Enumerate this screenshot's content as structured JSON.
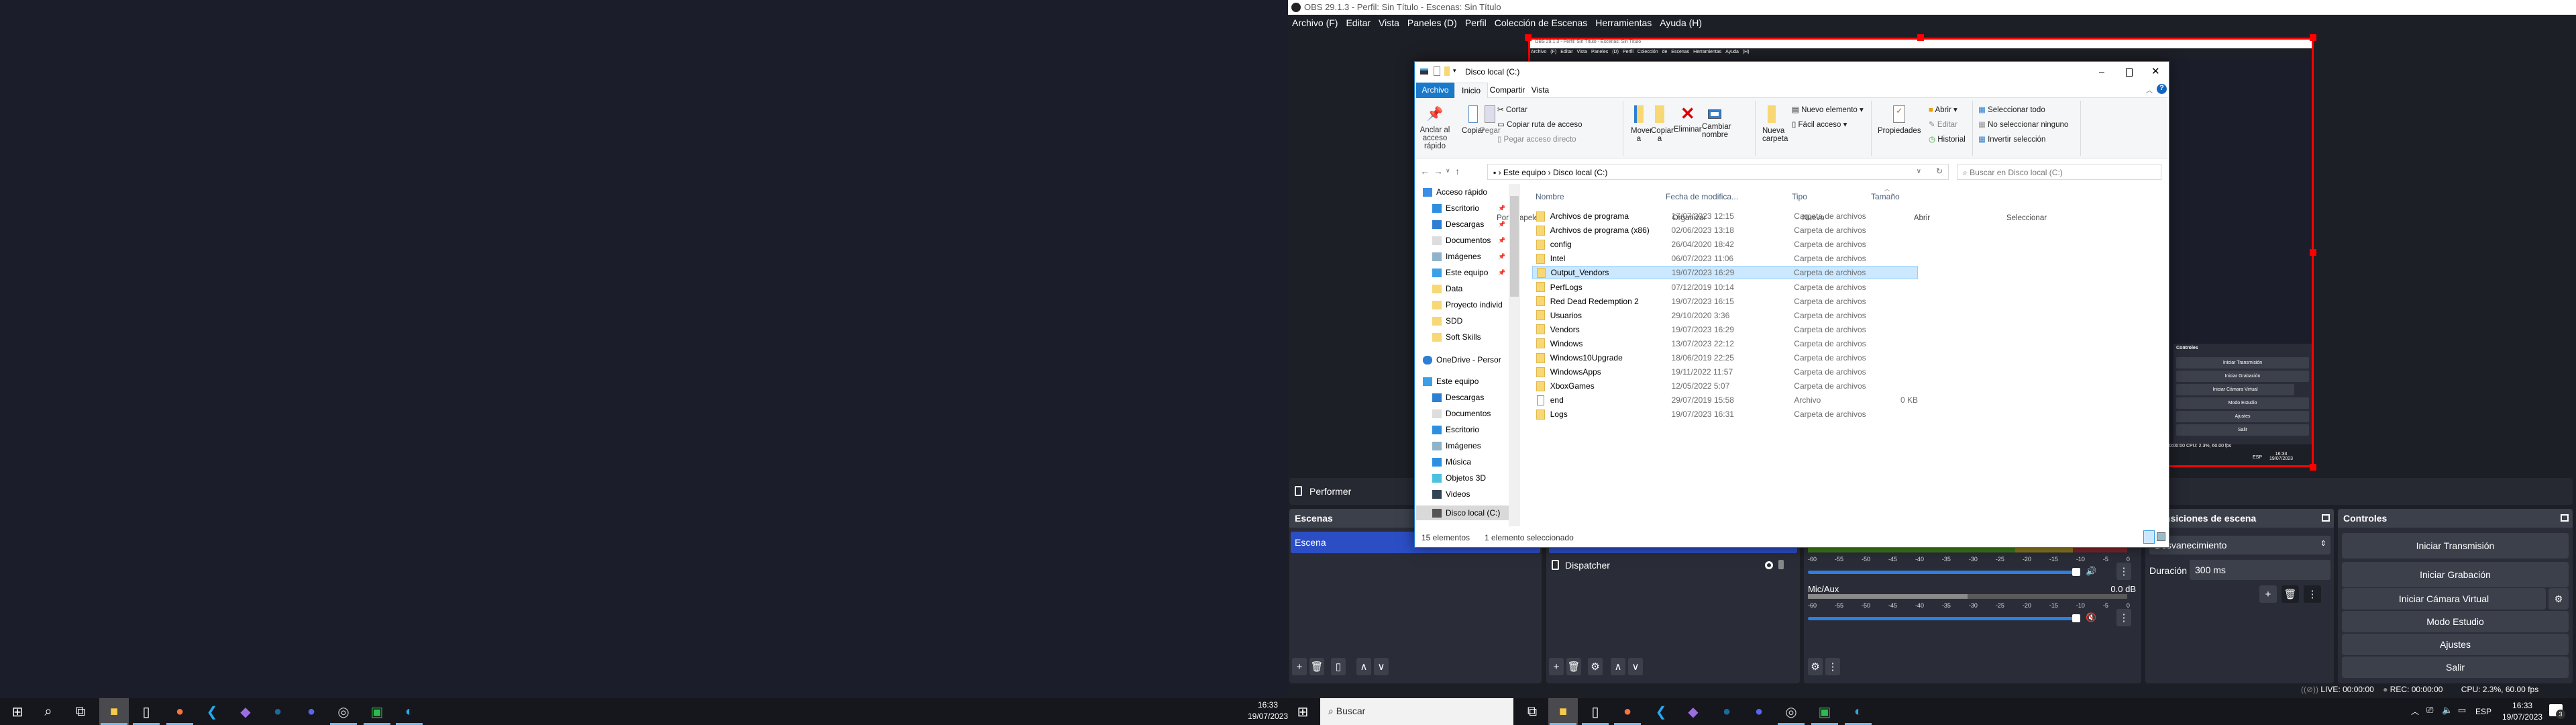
{
  "left_taskbar": {
    "apps": [
      "windows-start",
      "search",
      "task-view",
      "file-explorer",
      "notepad",
      "firefox",
      "vscode",
      "visual-studio",
      "steam",
      "discord",
      "obs",
      "green-app",
      "edge"
    ],
    "time": "16:33",
    "date": "19/07/2023"
  },
  "obs": {
    "title": "OBS 29.1.3 - Perfil: Sin Título - Escenas: Sin Título",
    "menu": [
      "Archivo (F)",
      "Editar",
      "Vista",
      "Paneles (D)",
      "Perfil",
      "Colección de Escenas",
      "Herramientas",
      "Ayuda (H)"
    ],
    "preview_source": "Performer",
    "scenes": {
      "title": "Escenas",
      "items": [
        "Escena"
      ]
    },
    "sources": {
      "items": [
        "Dispatcher"
      ]
    },
    "mixer": {
      "ticks": [
        "-60",
        "-55",
        "-50",
        "-45",
        "-40",
        "-35",
        "-30",
        "-25",
        "-20",
        "-15",
        "-10",
        "-5",
        "0"
      ],
      "channels": [
        {
          "name": "",
          "db": "",
          "volume": 1.0,
          "muted": false
        },
        {
          "name": "Mic/Aux",
          "db": "0.0 dB",
          "volume": 1.0,
          "muted": true
        }
      ]
    },
    "transitions": {
      "title": "Transiciones de escena",
      "selected": "Desvanecimiento",
      "duration_label": "Duración",
      "duration": "300 ms"
    },
    "controls": {
      "title": "Controles",
      "buttons": [
        "Iniciar Transmisión",
        "Iniciar Grabación",
        "Iniciar Cámara Virtual",
        "Modo Estudio",
        "Ajustes",
        "Salir"
      ]
    },
    "status": {
      "live": "LIVE: 00:00:00",
      "rec": "REC: 00:00:00",
      "cpu": "CPU: 2.3%, 60.00 fps"
    },
    "mini_status": ": 00:00:00   REC: 00:00:00   CPU: 2.3%, 60.00 fps",
    "mini_tray": {
      "lang": "ESP",
      "time": "16:33",
      "date": "19/07/2023"
    }
  },
  "explorer": {
    "title": "Disco local (C:)",
    "tabs": [
      "Archivo",
      "Inicio",
      "Compartir",
      "Vista"
    ],
    "ribbon": {
      "portapapeles": {
        "label": "Portapapeles",
        "anclar": "Anclar al acceso rápido",
        "copiar": "Copiar",
        "pegar": "Pegar",
        "cortar": "Cortar",
        "copiar_ruta": "Copiar ruta de acceso",
        "pegar_acceso": "Pegar acceso directo"
      },
      "organizar": {
        "label": "Organizar",
        "mover": "Mover a",
        "copiar_a": "Copiar a",
        "eliminar": "Eliminar",
        "cambiar": "Cambiar nombre"
      },
      "nuevo": {
        "label": "Nuevo",
        "carpeta": "Nueva carpeta",
        "elemento": "Nuevo elemento",
        "facil": "Fácil acceso"
      },
      "abrir": {
        "label": "Abrir",
        "propiedades": "Propiedades",
        "abrir": "Abrir",
        "editar": "Editar",
        "historial": "Historial"
      },
      "seleccionar": {
        "label": "Seleccionar",
        "todo": "Seleccionar todo",
        "ninguno": "No seleccionar ninguno",
        "invertir": "Invertir selección"
      }
    },
    "breadcrumb": [
      "Este equipo",
      "Disco local (C:)"
    ],
    "search_placeholder": "Buscar en Disco local (C:)",
    "nav": [
      {
        "label": "Acceso rápido",
        "icon": "star",
        "pinned": false,
        "level": 0
      },
      {
        "label": "Escritorio",
        "icon": "desktop",
        "pinned": true,
        "level": 1
      },
      {
        "label": "Descargas",
        "icon": "download",
        "pinned": true,
        "level": 1
      },
      {
        "label": "Documentos",
        "icon": "document",
        "pinned": true,
        "level": 1
      },
      {
        "label": "Imágenes",
        "icon": "image",
        "pinned": true,
        "level": 1
      },
      {
        "label": "Este equipo",
        "icon": "pc",
        "pinned": true,
        "level": 1
      },
      {
        "label": "Data",
        "icon": "folder",
        "pinned": false,
        "level": 1
      },
      {
        "label": "Proyecto individ",
        "icon": "folder",
        "pinned": false,
        "level": 1
      },
      {
        "label": "SDD",
        "icon": "folder",
        "pinned": false,
        "level": 1
      },
      {
        "label": "Soft Skills",
        "icon": "folder",
        "pinned": false,
        "level": 1
      },
      {
        "label": "OneDrive - Persor",
        "icon": "cloud",
        "pinned": false,
        "level": 0
      },
      {
        "label": "Este equipo",
        "icon": "pc",
        "pinned": false,
        "level": 0
      },
      {
        "label": "Descargas",
        "icon": "download",
        "pinned": false,
        "level": 1
      },
      {
        "label": "Documentos",
        "icon": "document",
        "pinned": false,
        "level": 1
      },
      {
        "label": "Escritorio",
        "icon": "desktop",
        "pinned": false,
        "level": 1
      },
      {
        "label": "Imágenes",
        "icon": "image",
        "pinned": false,
        "level": 1
      },
      {
        "label": "Música",
        "icon": "music",
        "pinned": false,
        "level": 1
      },
      {
        "label": "Objetos 3D",
        "icon": "cube",
        "pinned": false,
        "level": 1
      },
      {
        "label": "Videos",
        "icon": "video",
        "pinned": false,
        "level": 1
      },
      {
        "label": "Disco local (C:)",
        "icon": "drive",
        "pinned": false,
        "level": 1,
        "selected": true
      }
    ],
    "columns": [
      "Nombre",
      "Fecha de modifica...",
      "Tipo",
      "Tamaño"
    ],
    "files": [
      {
        "name": "Archivos de programa",
        "date": "17/07/2023 12:15",
        "type": "Carpeta de archivos",
        "size": ""
      },
      {
        "name": "Archivos de programa (x86)",
        "date": "02/06/2023 13:18",
        "type": "Carpeta de archivos",
        "size": ""
      },
      {
        "name": "config",
        "date": "26/04/2020 18:42",
        "type": "Carpeta de archivos",
        "size": ""
      },
      {
        "name": "Intel",
        "date": "06/07/2023 11:06",
        "type": "Carpeta de archivos",
        "size": ""
      },
      {
        "name": "Output_Vendors",
        "date": "19/07/2023 16:29",
        "type": "Carpeta de archivos",
        "size": "",
        "selected": true
      },
      {
        "name": "PerfLogs",
        "date": "07/12/2019 10:14",
        "type": "Carpeta de archivos",
        "size": ""
      },
      {
        "name": "Red Dead Redemption 2",
        "date": "19/07/2023 16:15",
        "type": "Carpeta de archivos",
        "size": ""
      },
      {
        "name": "Usuarios",
        "date": "29/10/2020 3:36",
        "type": "Carpeta de archivos",
        "size": ""
      },
      {
        "name": "Vendors",
        "date": "19/07/2023 16:29",
        "type": "Carpeta de archivos",
        "size": ""
      },
      {
        "name": "Windows",
        "date": "13/07/2023 22:12",
        "type": "Carpeta de archivos",
        "size": ""
      },
      {
        "name": "Windows10Upgrade",
        "date": "18/06/2019 22:25",
        "type": "Carpeta de archivos",
        "size": ""
      },
      {
        "name": "WindowsApps",
        "date": "19/11/2022 11:57",
        "type": "Carpeta de archivos",
        "size": ""
      },
      {
        "name": "XboxGames",
        "date": "12/05/2022 5:07",
        "type": "Carpeta de archivos",
        "size": ""
      },
      {
        "name": "end",
        "date": "29/07/2019 15:58",
        "type": "Archivo",
        "size": "0 KB",
        "file": true
      },
      {
        "name": "Logs",
        "date": "19/07/2023 16:31",
        "type": "Carpeta de archivos",
        "size": ""
      }
    ],
    "status": {
      "count": "15 elementos",
      "selection": "1 elemento seleccionado"
    }
  },
  "right_taskbar": {
    "search_placeholder": "Buscar",
    "lang": "ESP",
    "time": "16:33",
    "date": "19/07/2023",
    "notifications": "3"
  },
  "colors": {
    "obs_bg": "#1d1f26",
    "dock": "#2a2d38",
    "selected_scene": "#2c4ec5",
    "explorer_accent": "#1979ca",
    "selection_outline": "#ff0000"
  }
}
